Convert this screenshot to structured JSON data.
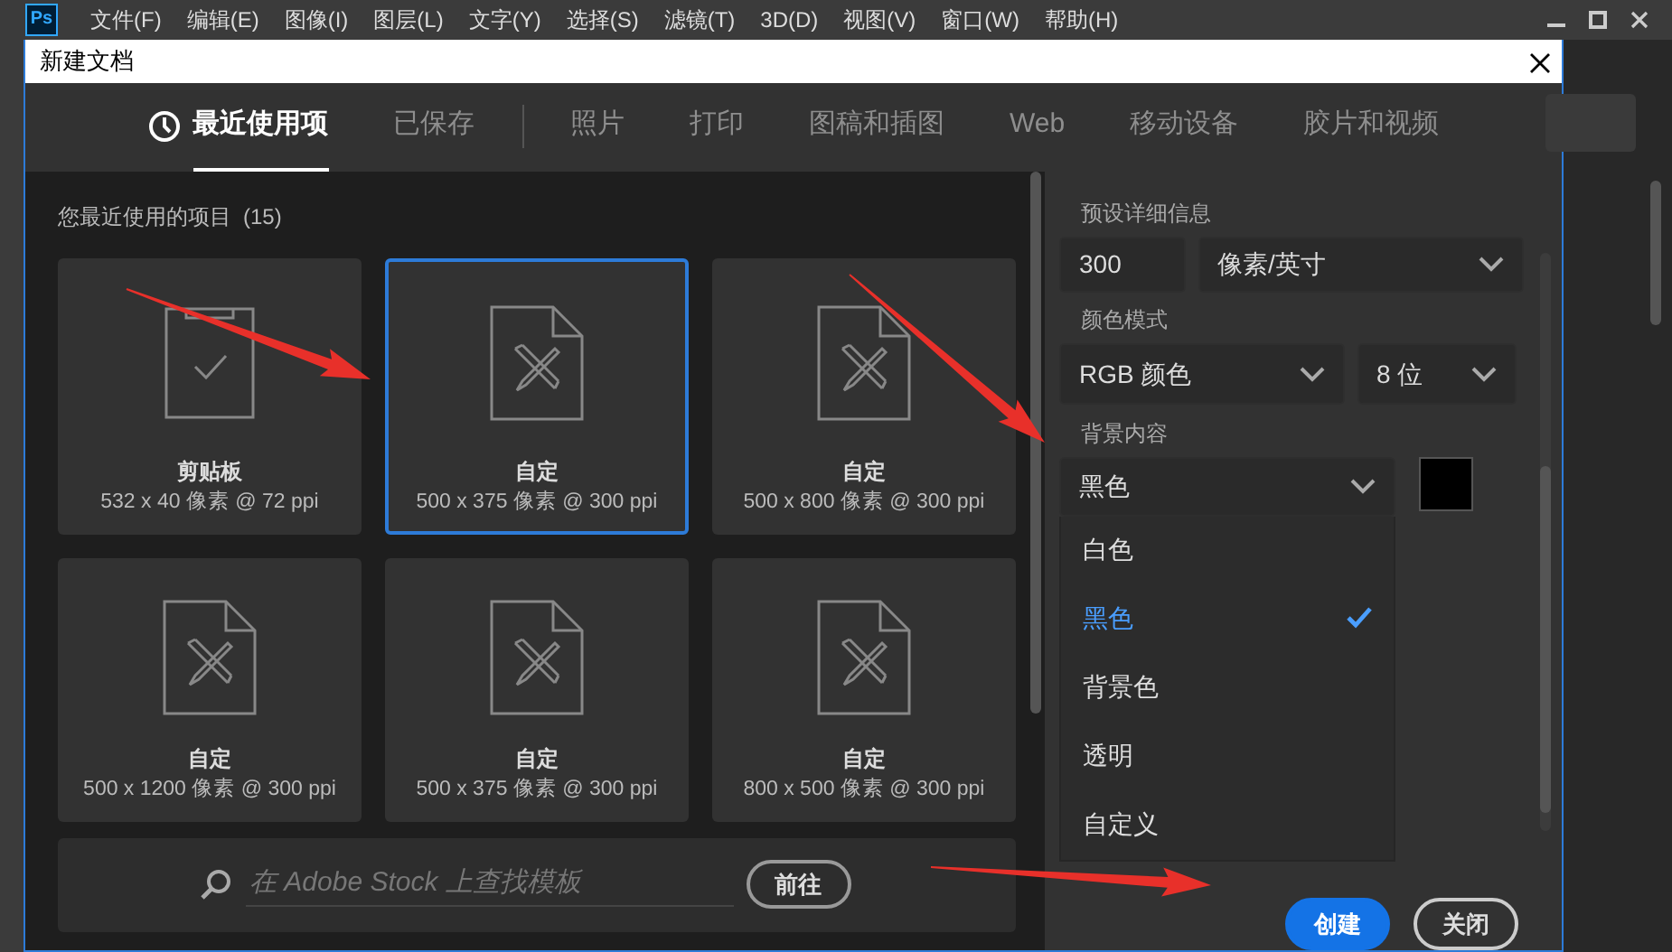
{
  "app": {
    "logo": "Ps",
    "menu": [
      "文件(F)",
      "编辑(E)",
      "图像(I)",
      "图层(L)",
      "文字(Y)",
      "选择(S)",
      "滤镜(T)",
      "3D(D)",
      "视图(V)",
      "窗口(W)",
      "帮助(H)"
    ]
  },
  "dialog": {
    "title": "新建文档",
    "tabs": [
      {
        "label": "最近使用项",
        "selected": true,
        "divider_after": false
      },
      {
        "label": "已保存",
        "selected": false,
        "divider_after": true
      },
      {
        "label": "照片",
        "selected": false,
        "divider_after": false
      },
      {
        "label": "打印",
        "selected": false,
        "divider_after": false
      },
      {
        "label": "图稿和插图",
        "selected": false,
        "divider_after": false
      },
      {
        "label": "Web",
        "selected": false,
        "divider_after": false
      },
      {
        "label": "移动设备",
        "selected": false,
        "divider_after": false
      },
      {
        "label": "胶片和视频",
        "selected": false,
        "divider_after": false
      }
    ],
    "recent": {
      "heading": "您最近使用的项目",
      "count": "(15)",
      "items": [
        {
          "kind": "clipboard",
          "name": "剪贴板",
          "size": "532 x 40 像素 @ 72 ppi",
          "selected": false
        },
        {
          "kind": "custom",
          "name": "自定",
          "size": "500 x 375 像素 @ 300 ppi",
          "selected": true
        },
        {
          "kind": "custom",
          "name": "自定",
          "size": "500 x 800 像素 @ 300 ppi",
          "selected": false
        },
        {
          "kind": "custom",
          "name": "自定",
          "size": "500 x 1200 像素 @ 300 ppi",
          "selected": false
        },
        {
          "kind": "custom",
          "name": "自定",
          "size": "500 x 375 像素 @ 300 ppi",
          "selected": false
        },
        {
          "kind": "custom",
          "name": "自定",
          "size": "800 x 500 像素 @ 300 ppi",
          "selected": false
        }
      ]
    },
    "search": {
      "placeholder": "在 Adobe Stock 上查找模板",
      "button": "前往"
    },
    "details": {
      "heading": "预设详细信息",
      "resolution": "300",
      "resolution_unit": "像素/英寸",
      "color_mode_label": "颜色模式",
      "color_mode": "RGB 颜色",
      "bit_depth": "8 位",
      "background_label": "背景内容",
      "background": "黑色",
      "background_options": [
        {
          "label": "白色",
          "selected": false
        },
        {
          "label": "黑色",
          "selected": true
        },
        {
          "label": "背景色",
          "selected": false
        },
        {
          "label": "透明",
          "selected": false
        },
        {
          "label": "自定义",
          "selected": false
        }
      ]
    },
    "buttons": [
      {
        "label": "创建",
        "kind": "primary"
      },
      {
        "label": "关闭",
        "kind": "secondary"
      }
    ]
  }
}
